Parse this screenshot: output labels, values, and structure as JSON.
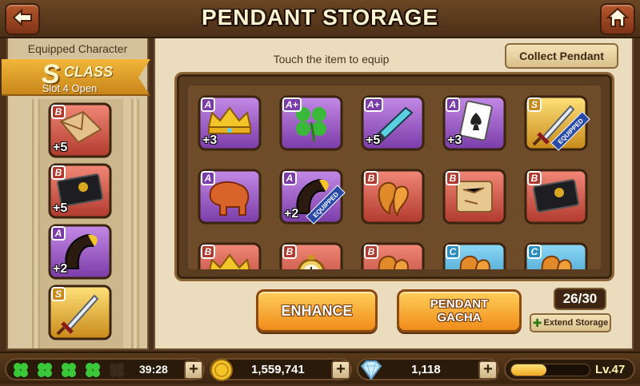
{
  "header": {
    "title": "PENDANT STORAGE",
    "back_icon": "back-arrow-icon",
    "home_icon": "home-icon"
  },
  "left_panel": {
    "header": "Equipped Character",
    "class_letter": "S",
    "class_word": "CLASS",
    "slot_text": "Slot 4 Open",
    "equipped": [
      {
        "grade": "B",
        "item": "envelope",
        "level": "+5"
      },
      {
        "grade": "B",
        "item": "black-card",
        "level": "+5"
      },
      {
        "grade": "A",
        "item": "horn",
        "level": "+2"
      },
      {
        "grade": "S",
        "item": "sword",
        "level": ""
      }
    ]
  },
  "main": {
    "instruction": "Touch the item to equip",
    "collect_button": "Collect Pendant",
    "items": [
      {
        "grade": "A",
        "item": "crown",
        "level": "+3",
        "equipped": false
      },
      {
        "grade": "A+",
        "item": "clover",
        "level": "",
        "equipped": false
      },
      {
        "grade": "A+",
        "item": "blade",
        "level": "+5",
        "equipped": false
      },
      {
        "grade": "A",
        "item": "spade-card",
        "level": "+3",
        "equipped": false
      },
      {
        "grade": "S",
        "item": "sword",
        "level": "",
        "equipped": true
      },
      {
        "grade": "A",
        "item": "elephant",
        "level": "",
        "equipped": false
      },
      {
        "grade": "A",
        "item": "horn",
        "level": "+2",
        "equipped": true
      },
      {
        "grade": "B",
        "item": "claws",
        "level": "",
        "equipped": false
      },
      {
        "grade": "B",
        "item": "scroll-map",
        "level": "",
        "equipped": false
      },
      {
        "grade": "B",
        "item": "black-card",
        "level": "",
        "equipped": false
      },
      {
        "grade": "B",
        "item": "crown",
        "level": "",
        "equipped": false
      },
      {
        "grade": "B",
        "item": "pocket-watch",
        "level": "",
        "equipped": false
      },
      {
        "grade": "B",
        "item": "claws",
        "level": "",
        "equipped": false
      },
      {
        "grade": "C",
        "item": "claws",
        "level": "",
        "equipped": false
      },
      {
        "grade": "C",
        "item": "claws",
        "level": "",
        "equipped": false
      }
    ],
    "equipped_tag": "EQUIPPED",
    "enhance_button": "ENHANCE",
    "gacha_line1": "PENDANT",
    "gacha_line2": "GACHA",
    "storage_count": "26/30",
    "extend_button": "Extend Storage"
  },
  "footer": {
    "clovers_full": 4,
    "clovers_total": 5,
    "timer": "39:28",
    "gold": "1,559,741",
    "gems": "1,118",
    "xp_fraction": 0.45,
    "level": "Lv.47"
  },
  "colors": {
    "grade_A": "#9a5cc8",
    "grade_Aplus": "#9a5cc8",
    "grade_S": "#e6b43a",
    "grade_B": "#d8564a",
    "grade_C": "#3ab0e0",
    "button_orange": "#f5a832"
  }
}
